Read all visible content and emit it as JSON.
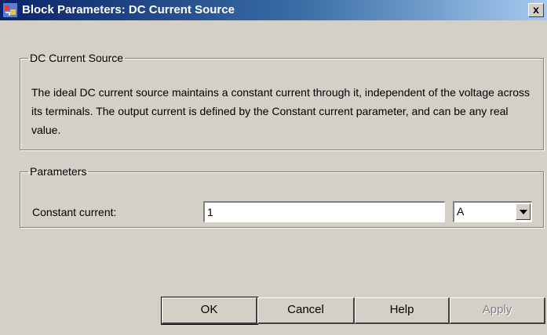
{
  "window": {
    "title": "Block Parameters: DC Current Source",
    "close_glyph": "x",
    "icon": "simulink-block-icon"
  },
  "description_group": {
    "legend": "DC Current Source",
    "text": "The ideal DC current source maintains a constant current through it, independent of the voltage across its terminals. The output current is defined by the Constant current parameter, and can be any real value."
  },
  "parameters_group": {
    "legend": "Parameters",
    "constant_current": {
      "label": "Constant current:",
      "value": "1",
      "unit": "A"
    }
  },
  "buttons": {
    "ok": "OK",
    "cancel": "Cancel",
    "help": "Help",
    "apply": "Apply"
  }
}
